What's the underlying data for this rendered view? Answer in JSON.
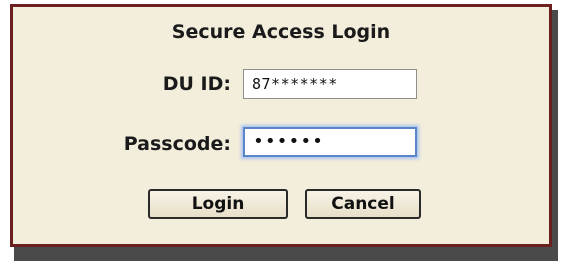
{
  "login": {
    "title": "Secure Access Login",
    "duid_label": "DU ID:",
    "duid_value": "87*******",
    "passcode_label": "Passcode:",
    "passcode_value": "••••••",
    "login_button": "Login",
    "cancel_button": "Cancel"
  },
  "colors": {
    "panel_background": "#f3eddb",
    "panel_border": "#6b1f1f",
    "focus_ring": "#5a86c9",
    "shadow": "#4a4a4a"
  }
}
